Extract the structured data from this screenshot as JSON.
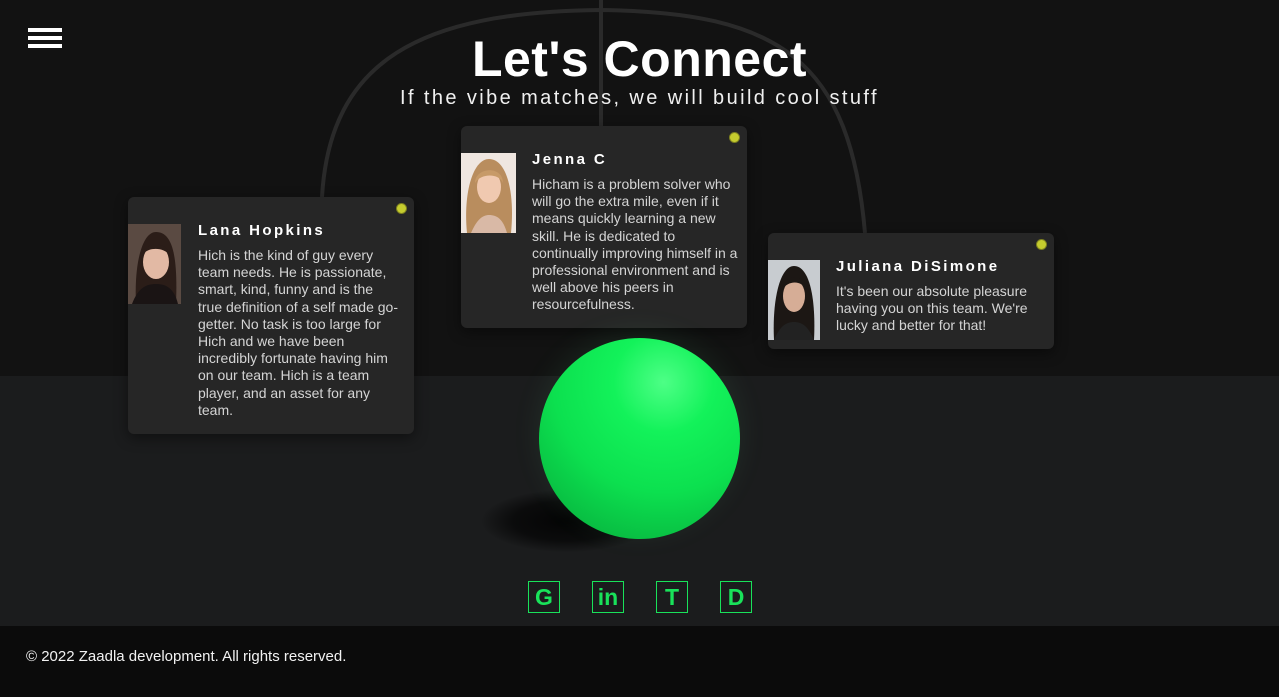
{
  "header": {
    "title": "Let's Connect",
    "subtitle": "If the vibe matches, we will build cool stuff"
  },
  "menu": {
    "icon": "hamburger-menu-icon"
  },
  "testimonials": [
    {
      "name": "Lana Hopkins",
      "text": "Hich is the kind of guy every team needs. He is passionate, smart, kind, funny and is the true definition of a self made go-getter. No task is too large for Hich and we have been incredibly fortunate having him on our team. Hich is a team player, and an asset for any team."
    },
    {
      "name": "Jenna C",
      "text": "Hicham is a problem solver who will go the extra mile, even if it means quickly learning a new skill. He is dedicated to continually improving himself in a professional environment and is well above his peers in resourcefulness."
    },
    {
      "name": "Juliana DiSimone",
      "text": "It's been our absolute pleasure having you on this team. We're lucky and better for that!"
    }
  ],
  "socials": [
    {
      "label": "G",
      "icon": "github-icon"
    },
    {
      "label": "in",
      "icon": "linkedin-icon"
    },
    {
      "label": "T",
      "icon": "twitter-icon"
    },
    {
      "label": "D",
      "icon": "dribbble-icon"
    }
  ],
  "colors": {
    "accent": "#19e25a",
    "ball": "#0ce04f",
    "status_dot": "#c5cc2e",
    "background": "#121212",
    "card": "#262626"
  },
  "footer": {
    "copyright": "© 2022 Zaadla development. All rights reserved."
  }
}
